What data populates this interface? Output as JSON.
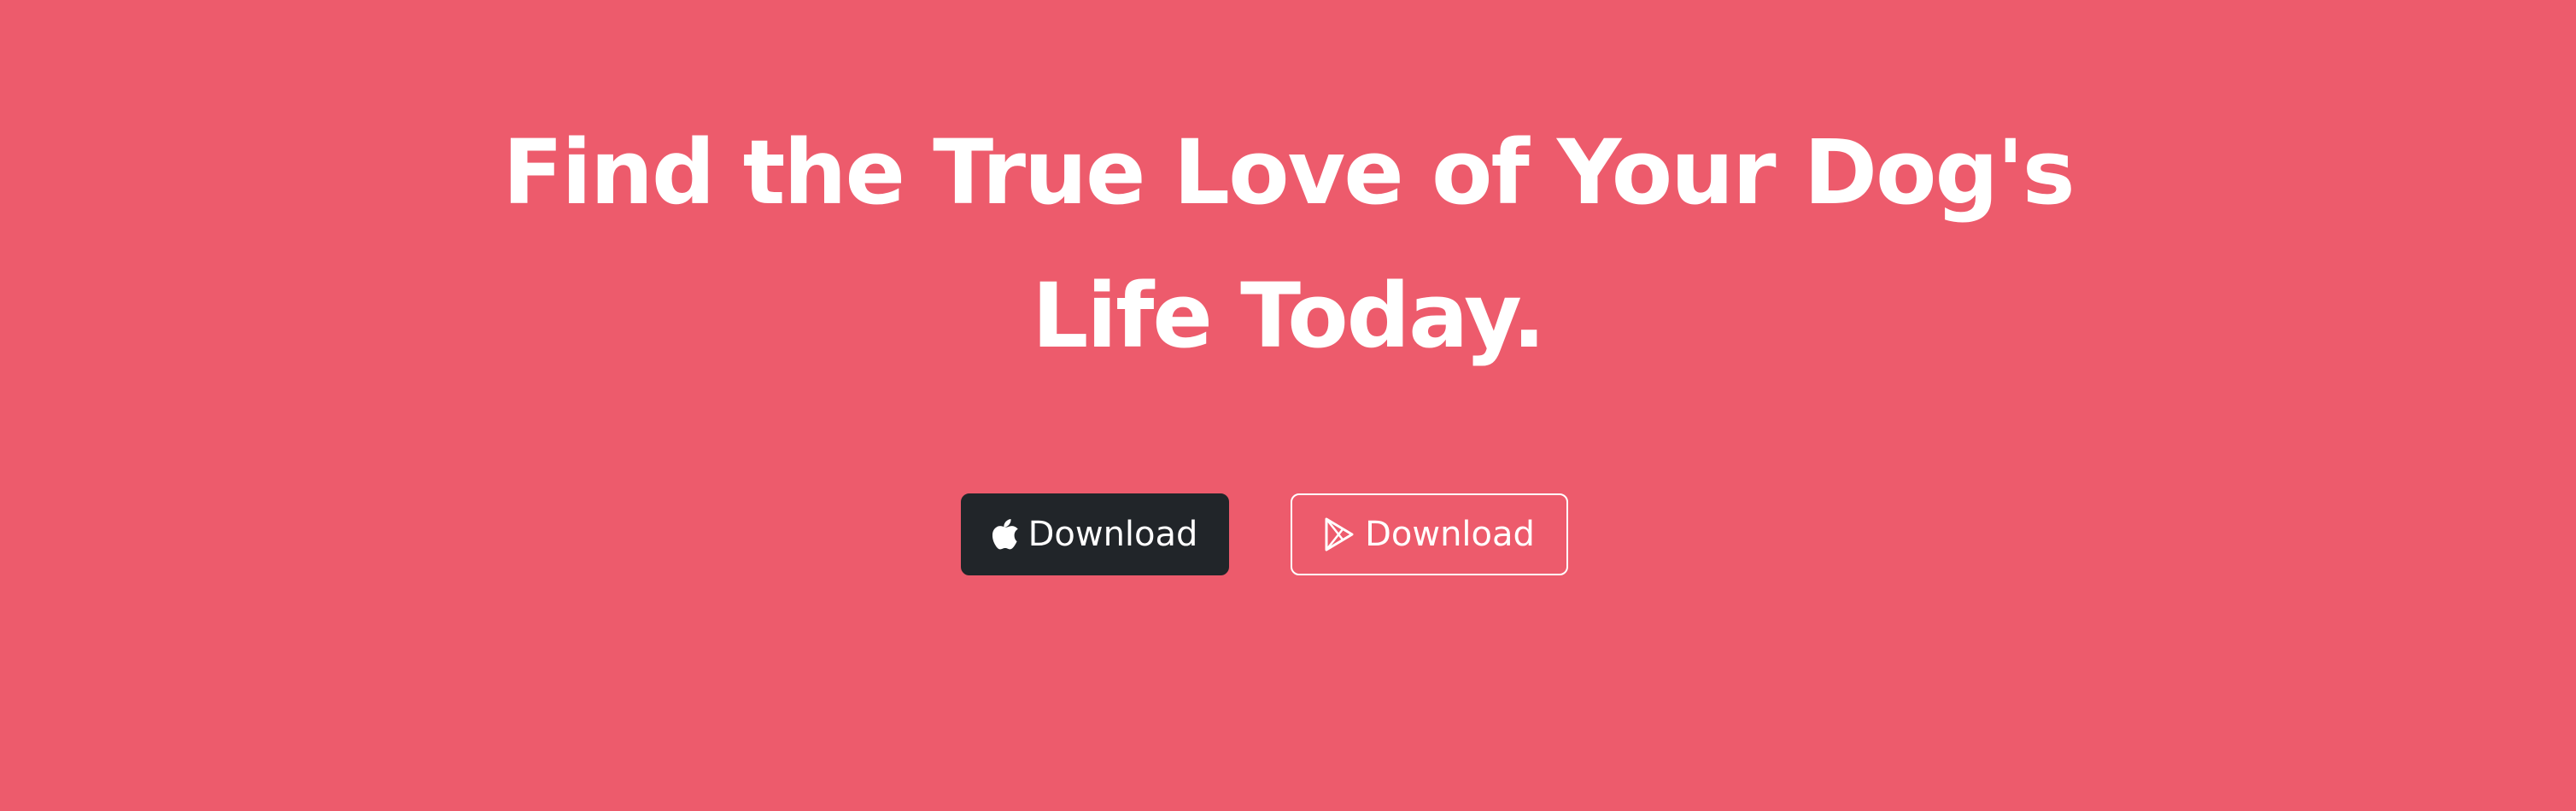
{
  "hero": {
    "headline_line1": "Find the True Love of Your Dog's",
    "headline_line2": "Life Today.",
    "background_color": "#ed5b6c"
  },
  "buttons": {
    "apple": {
      "label": "Download",
      "icon": "apple-icon",
      "background_color": "#212529"
    },
    "play": {
      "label": "Download",
      "icon": "google-play-icon",
      "border_color": "#ffffff"
    }
  }
}
